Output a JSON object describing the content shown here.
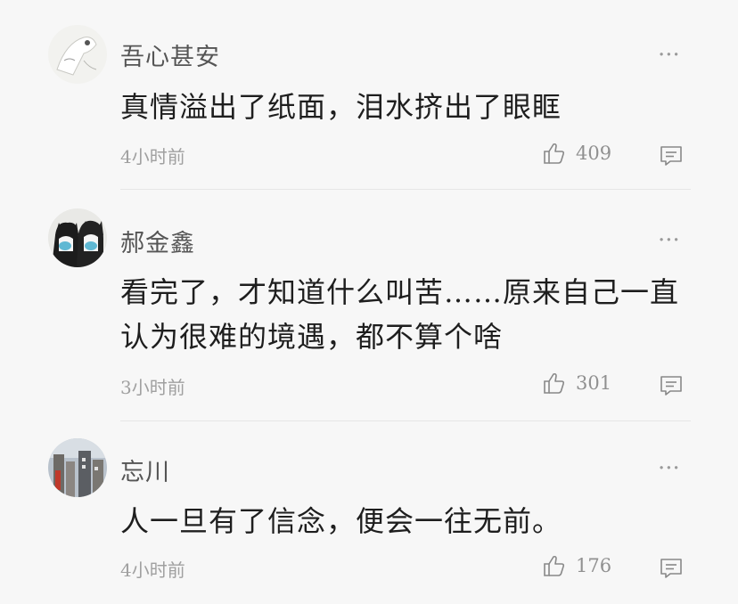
{
  "comments": [
    {
      "username": "吾心甚安",
      "content": "真情溢出了纸面，泪水挤出了眼眶",
      "time": "4小时前",
      "likes": "409",
      "more_label": "···"
    },
    {
      "username": "郝金鑫",
      "content": "看完了，才知道什么叫苦……原来自己一直认为很难的境遇，都不算个啥",
      "time": "3小时前",
      "likes": "301",
      "more_label": "···"
    },
    {
      "username": "忘川",
      "content": "人一旦有了信念，便会一往无前。",
      "time": "4小时前",
      "likes": "176",
      "more_label": "···"
    }
  ],
  "icons": {
    "like": "thumbs-up-icon",
    "reply": "comment-icon",
    "more": "more-options-icon"
  },
  "colors": {
    "background": "#f7f7f7",
    "text": "#1e1e1e",
    "meta": "#a0a0a0"
  }
}
